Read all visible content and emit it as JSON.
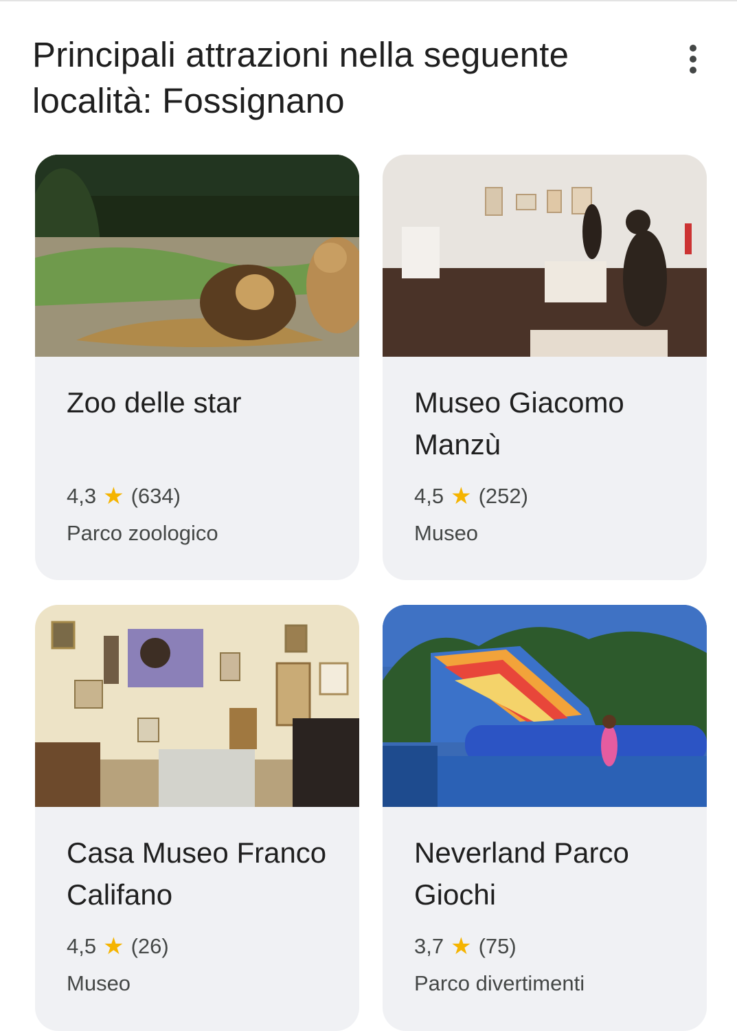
{
  "header": {
    "title": "Principali attrazioni nella seguente località: Fossignano",
    "more_icon": "more-vert-icon"
  },
  "attractions": [
    {
      "name": "Zoo delle star",
      "rating": "4,3",
      "reviews": "(634)",
      "category": "Parco zoologico",
      "photo": "lions-photo"
    },
    {
      "name": "Museo Giacomo Manzù",
      "rating": "4,5",
      "reviews": "(252)",
      "category": "Museo",
      "photo": "sculpture-gallery-photo"
    },
    {
      "name": "Casa Museo Franco Califano",
      "rating": "4,5",
      "reviews": "(26)",
      "category": "Museo",
      "photo": "memorabilia-room-photo"
    },
    {
      "name": "Neverland Parco Giochi",
      "rating": "3,7",
      "reviews": "(75)",
      "category": "Parco divertimenti",
      "photo": "inflatable-slide-photo"
    }
  ],
  "colors": {
    "card_bg": "#f0f1f4",
    "star": "#f5b400",
    "text_secondary": "#444746"
  }
}
